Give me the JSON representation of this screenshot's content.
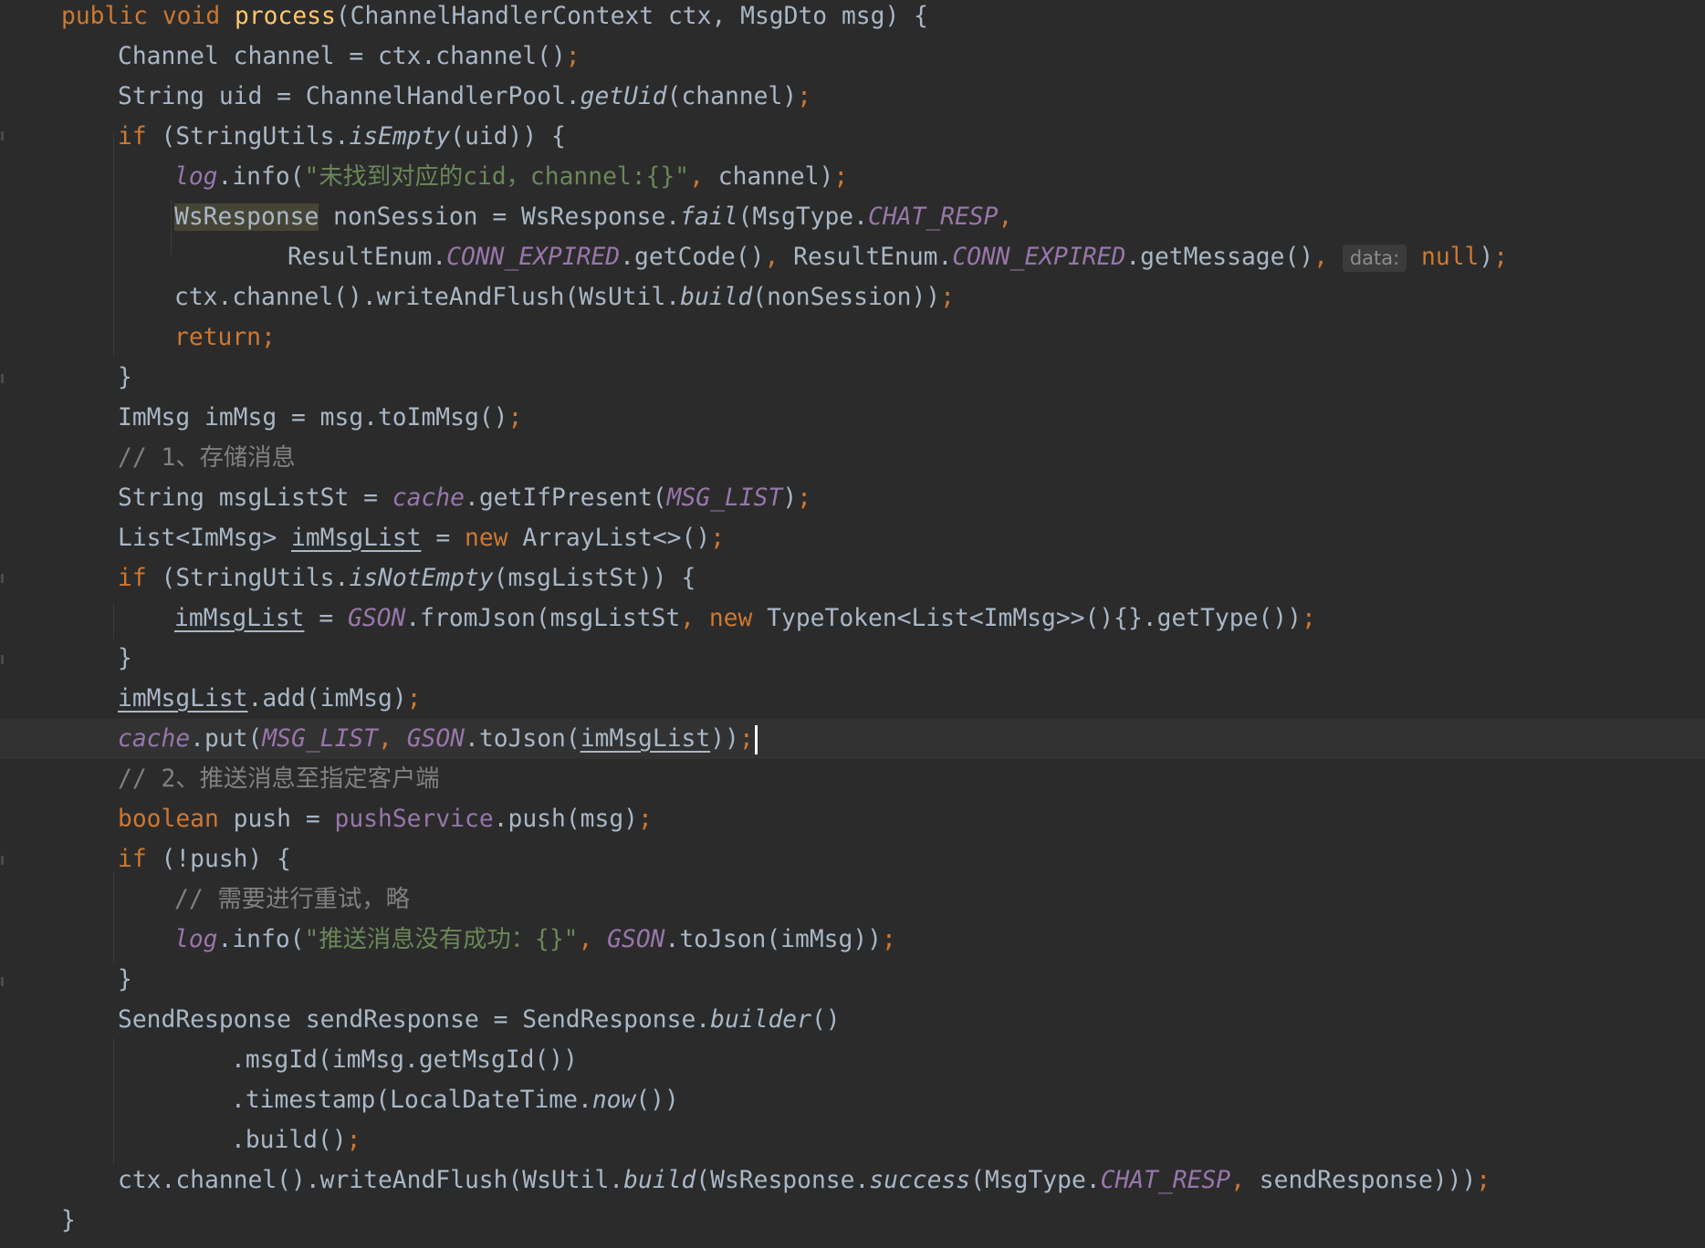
{
  "editor": {
    "lines": [
      [
        "public void ",
        "process",
        "(ChannelHandlerContext ctx, MsgDto msg) {"
      ],
      [
        "Channel channel = ctx.channel()",
        ";"
      ],
      [
        "String uid = ChannelHandlerPool.",
        "getUid",
        "(channel)",
        ";"
      ],
      [
        "if ",
        "(StringUtils.",
        "isEmpty",
        "(uid)) {"
      ],
      [
        "log",
        ".info(",
        "\"未找到对应的cid，channel:{}\"",
        ", ",
        "channel)",
        ";"
      ],
      [
        "WsResponse",
        " nonSession = WsResponse.",
        "fail",
        "(MsgType.",
        "CHAT_RESP",
        ","
      ],
      [
        "ResultEnum.",
        "CONN_EXPIRED",
        ".getCode()",
        ", ",
        "ResultEnum.",
        "CONN_EXPIRED",
        ".getMessage()",
        ", ",
        "data:",
        "null",
        ")",
        ";"
      ],
      [
        "ctx.channel().writeAndFlush(WsUtil.",
        "build",
        "(nonSession))",
        ";"
      ],
      [
        "return;"
      ],
      [
        "}"
      ],
      [
        "ImMsg imMsg = msg.toImMsg()",
        ";"
      ],
      [
        "// 1、存储消息"
      ],
      [
        "String msgListSt = ",
        "cache",
        ".getIfPresent(",
        "MSG_LIST",
        ")",
        ";"
      ],
      [
        "List<ImMsg> ",
        "imMsgList",
        " = ",
        "new ",
        "ArrayList<>()",
        ";"
      ],
      [
        "if ",
        "(StringUtils.",
        "isNotEmpty",
        "(msgListSt)) {"
      ],
      [
        "imMsgList",
        " = ",
        "GSON",
        ".fromJson(msgListSt",
        ", ",
        "new ",
        "TypeToken<List<ImMsg>>(){}.getType())",
        ";"
      ],
      [
        "}"
      ],
      [
        "imMsgList",
        ".add(imMsg)",
        ";"
      ],
      [
        "cache",
        ".put(",
        "MSG_LIST",
        ", ",
        "GSON",
        ".toJson(",
        "imMsgList",
        "))",
        ";"
      ],
      [
        "// 2、推送消息至指定客户端"
      ],
      [
        "boolean ",
        "push = ",
        "pushService",
        ".push(msg)",
        ";"
      ],
      [
        "if ",
        "(!push) {"
      ],
      [
        "// 需要进行重试，略"
      ],
      [
        "log",
        ".info(",
        "\"推送消息没有成功：{}\"",
        ", ",
        "GSON",
        ".toJson(imMsg))",
        ";"
      ],
      [
        "}"
      ],
      [
        "SendResponse sendResponse = SendResponse.",
        "builder",
        "()"
      ],
      [
        ".msgId(imMsg.getMsgId())"
      ],
      [
        ".timestamp(LocalDateTime.",
        "now",
        "())"
      ],
      [
        ".build()",
        ";"
      ],
      [
        "ctx.channel().writeAndFlush(WsUtil.",
        "build",
        "(WsResponse.",
        "success",
        "(MsgType.",
        "CHAT_RESP",
        ", ",
        "sendResponse)))",
        ";"
      ],
      [
        "}"
      ]
    ]
  },
  "colors": {
    "background": "#2b2b2b",
    "current_line": "#323232",
    "default_text": "#a9b7c6",
    "keyword": "#cc7832",
    "method_declaration": "#ffc66d",
    "field": "#9876aa",
    "string": "#6a8759",
    "comment": "#808080",
    "usage_highlight": "#464535",
    "inlay_hint_bg": "#3b3b3b"
  }
}
